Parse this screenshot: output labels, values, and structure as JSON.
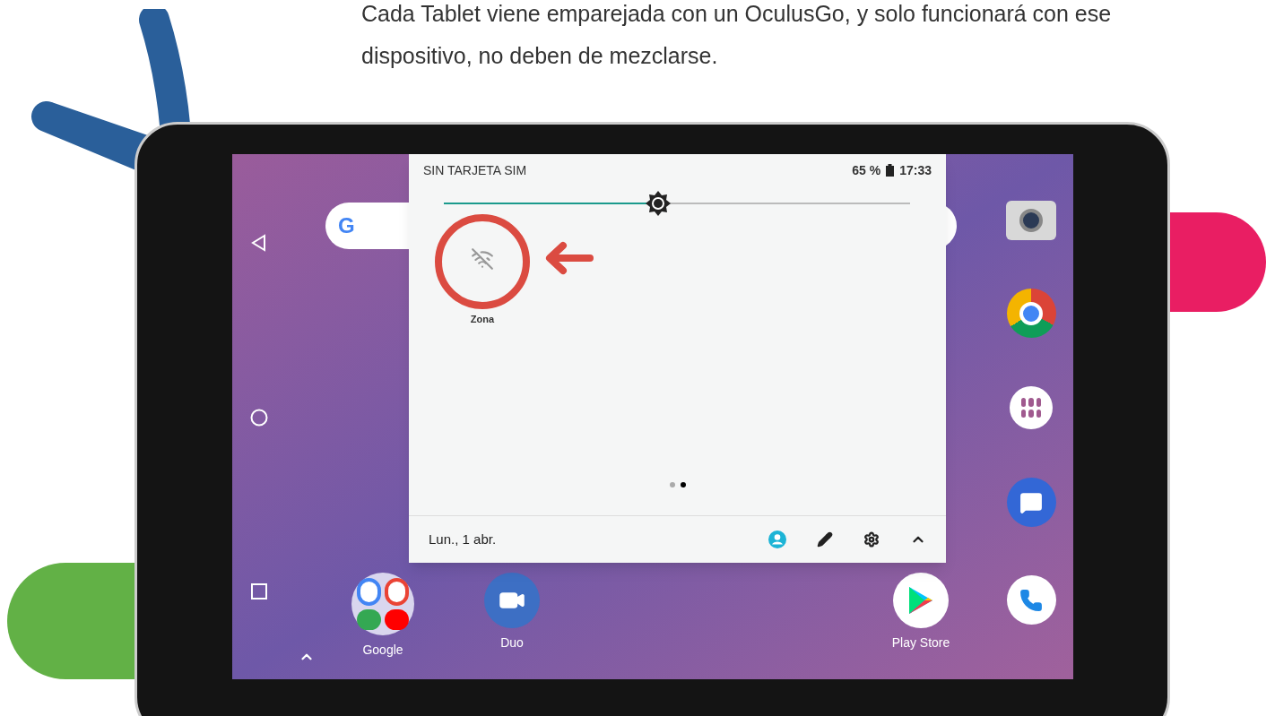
{
  "caption": "Cada Tablet viene emparejada con un OculusGo, y solo funcionará con ese dispositivo, no deben de mezclarse.",
  "search_bar": {
    "logo": "G"
  },
  "status_bar": {
    "carrier": "SIN TARJETA SIM",
    "battery": "65 %",
    "time": "17:33"
  },
  "brightness": {
    "level": 0.46
  },
  "quick_tiles": [
    {
      "label": "Zona",
      "on": false,
      "highlighted": true
    }
  ],
  "pages": [
    {
      "selected": false
    },
    {
      "selected": true
    }
  ],
  "footer": {
    "date": "Lun., 1 abr."
  },
  "home_apps": [
    {
      "label": "Google",
      "kind": "folder"
    },
    {
      "label": "Duo",
      "kind": "duo"
    },
    {
      "label": "Play Store",
      "kind": "play"
    }
  ]
}
